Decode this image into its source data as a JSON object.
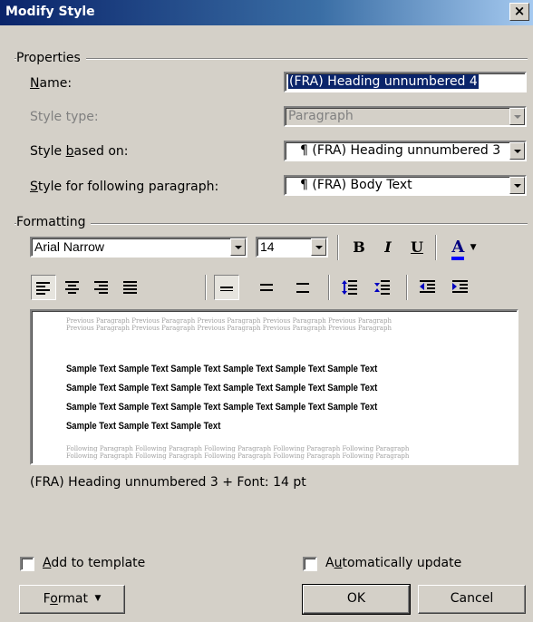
{
  "window": {
    "title": "Modify Style",
    "close_glyph": "×"
  },
  "properties": {
    "group_label": "Properties",
    "name_label": {
      "pre": "",
      "key": "N",
      "post": "ame:"
    },
    "name_value": "(FRA) Heading unnumbered 4",
    "style_type_label": "Style type:",
    "style_type_value": "Paragraph",
    "based_on_label": {
      "pre": "Style ",
      "key": "b",
      "post": "ased on:"
    },
    "based_on_value": "¶ (FRA) Heading unnumbered 3",
    "following_label": {
      "pre": "",
      "key": "S",
      "post": "tyle for following paragraph:"
    },
    "following_value": "¶ (FRA) Body Text"
  },
  "formatting": {
    "group_label": "Formatting",
    "font": "Arial Narrow",
    "size": "14",
    "bold_glyph": "B",
    "italic_glyph": "I",
    "underline_glyph": "U",
    "font_color_glyph": "A",
    "font_color": "#0000ff"
  },
  "preview": {
    "previous_line": "Previous Paragraph Previous Paragraph Previous Paragraph Previous Paragraph Previous Paragraph",
    "sample_lines": [
      "Sample Text Sample Text Sample Text Sample Text Sample Text Sample Text",
      "Sample Text Sample Text Sample Text Sample Text Sample Text Sample Text",
      "Sample Text Sample Text Sample Text Sample Text Sample Text Sample Text",
      "Sample Text Sample Text Sample Text"
    ],
    "following_line": "Following Paragraph Following Paragraph Following Paragraph Following Paragraph Following Paragraph"
  },
  "description": "(FRA) Heading unnumbered 3 + Font: 14 pt",
  "options": {
    "add_to_template": {
      "pre": "",
      "key": "A",
      "post": "dd to template"
    },
    "auto_update": {
      "pre": "A",
      "key": "u",
      "post": "tomatically update"
    }
  },
  "buttons": {
    "format": {
      "pre": "F",
      "key": "o",
      "post": "rmat"
    },
    "ok": "OK",
    "cancel": "Cancel"
  }
}
